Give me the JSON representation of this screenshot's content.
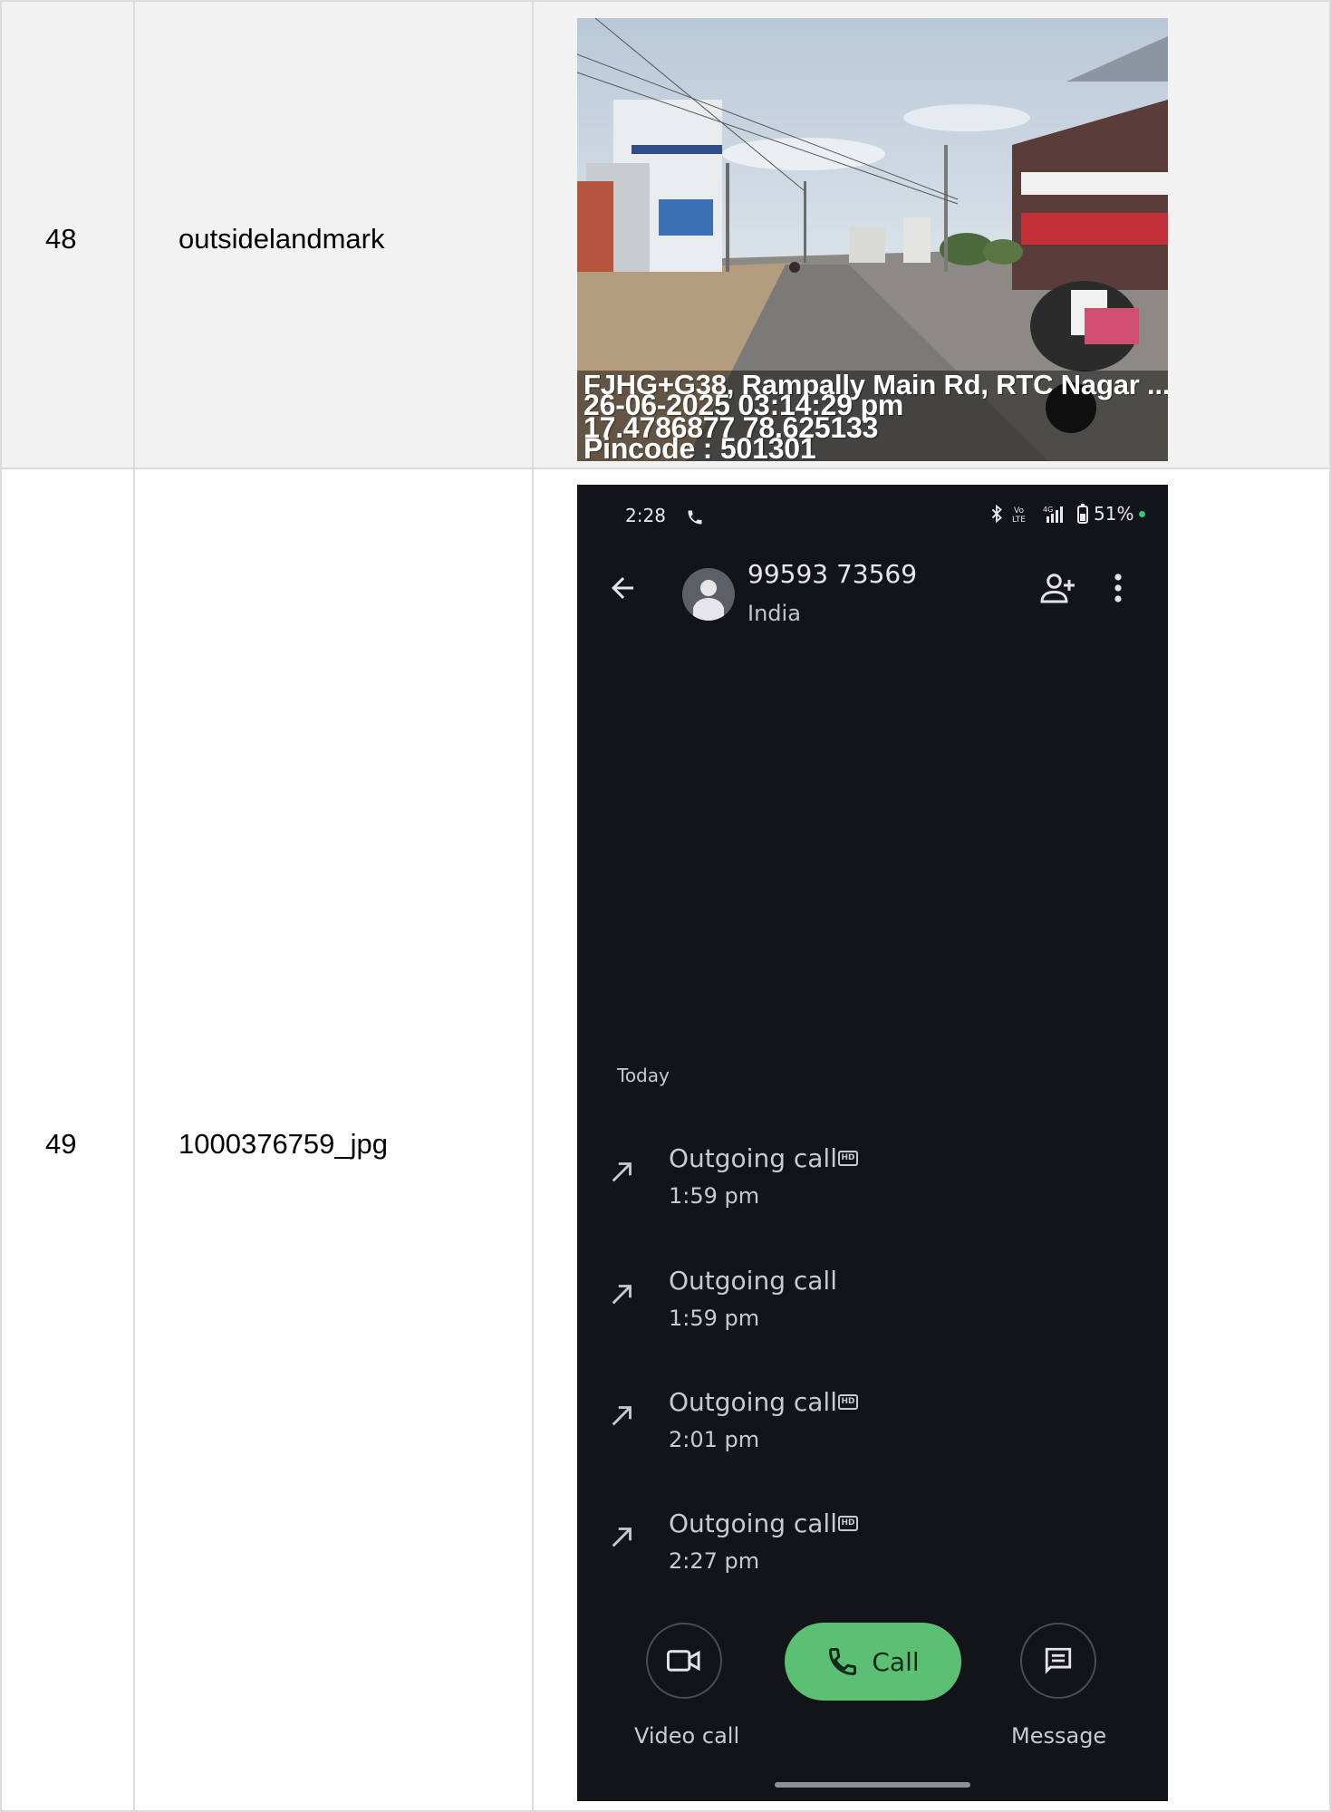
{
  "rows": [
    {
      "number": "48",
      "name": "outsidelandmark",
      "photo_overlay": {
        "address": "FJHG+G38, Rampally Main Rd, RTC Nagar ...",
        "datetime": "26-06-2025 03:14:29 pm",
        "coordinates": "17.4786877 78.625133",
        "pincode": "Pincode : 501301"
      }
    },
    {
      "number": "49",
      "name": "1000376759_jpg",
      "phone": {
        "status_bar": {
          "time": "2:28",
          "battery": "51%"
        },
        "contact": {
          "number": "99593 73569",
          "country": "India"
        },
        "section_label": "Today",
        "calls": [
          {
            "type": "Outgoing call",
            "time": "1:59 pm",
            "hd": true
          },
          {
            "type": "Outgoing call",
            "time": "1:59 pm",
            "hd": false
          },
          {
            "type": "Outgoing call",
            "time": "2:01 pm",
            "hd": true
          },
          {
            "type": "Outgoing call",
            "time": "2:27 pm",
            "hd": true
          }
        ],
        "actions": {
          "video_call": "Video call",
          "call": "Call",
          "message": "Message"
        }
      }
    }
  ],
  "icons": {
    "back": "arrow-left-icon",
    "add_contact": "person-add-icon",
    "more": "more-vert-icon",
    "outgoing": "call-made-icon",
    "video": "videocam-icon",
    "phone": "phone-icon",
    "message": "message-icon"
  },
  "colors": {
    "phone_bg": "#131419",
    "call_button": "#5bbf74",
    "battery_dot": "#2ecc71"
  }
}
